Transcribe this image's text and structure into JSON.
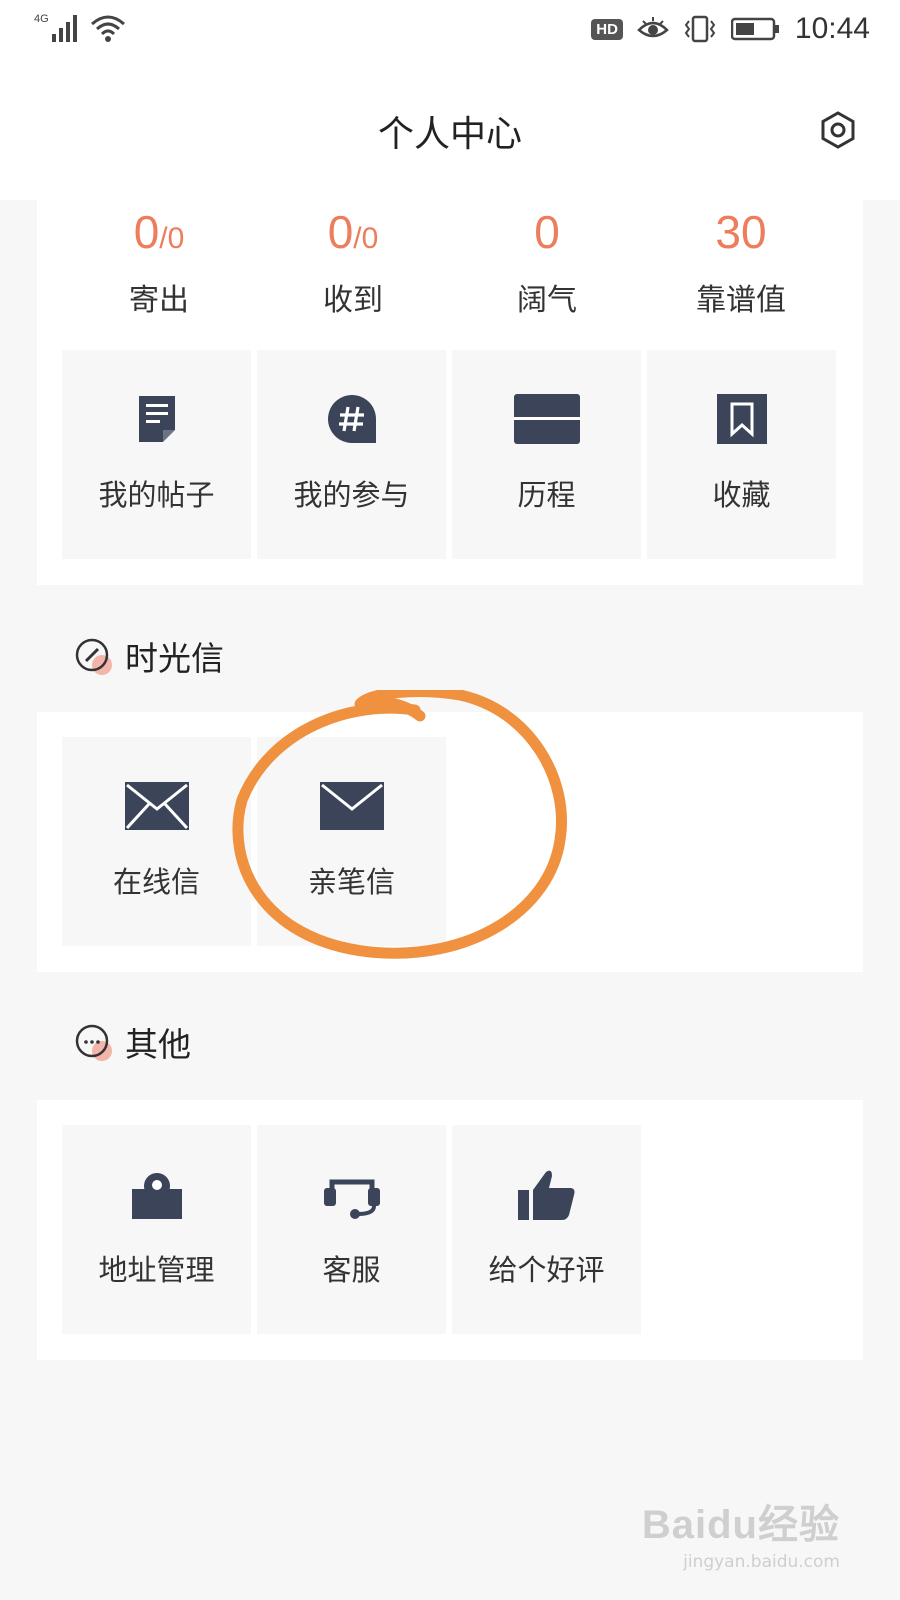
{
  "status_bar": {
    "network": "4G",
    "hd_badge": "HD",
    "time": "10:44"
  },
  "header": {
    "title": "个人中心"
  },
  "stats": [
    {
      "value": "0",
      "sub": "/0",
      "label": "寄出"
    },
    {
      "value": "0",
      "sub": "/0",
      "label": "收到"
    },
    {
      "value": "0",
      "sub": "",
      "label": "阔气"
    },
    {
      "value": "30",
      "sub": "",
      "label": "靠谱值"
    }
  ],
  "main_tiles": [
    {
      "label": "我的帖子",
      "icon": "post-icon"
    },
    {
      "label": "我的参与",
      "icon": "hashtag-icon"
    },
    {
      "label": "历程",
      "icon": "history-icon"
    },
    {
      "label": "收藏",
      "icon": "bookmark-icon"
    }
  ],
  "letters_section": {
    "title": "时光信",
    "icon": "compass-icon",
    "tiles": [
      {
        "label": "在线信",
        "icon": "envelope-icon"
      },
      {
        "label": "亲笔信",
        "icon": "envelope-icon"
      }
    ]
  },
  "others_section": {
    "title": "其他",
    "icon": "more-icon",
    "tiles": [
      {
        "label": "地址管理",
        "icon": "location-pin-icon"
      },
      {
        "label": "客服",
        "icon": "headset-icon"
      },
      {
        "label": "给个好评",
        "icon": "thumbs-up-icon"
      }
    ]
  },
  "watermark": {
    "logo": "Baidu经验",
    "url": "jingyan.baidu.com"
  },
  "colors": {
    "accent": "#ed7d5c",
    "icon": "#3b4458",
    "annotation": "#f0913f",
    "background": "#f7f7f7"
  }
}
